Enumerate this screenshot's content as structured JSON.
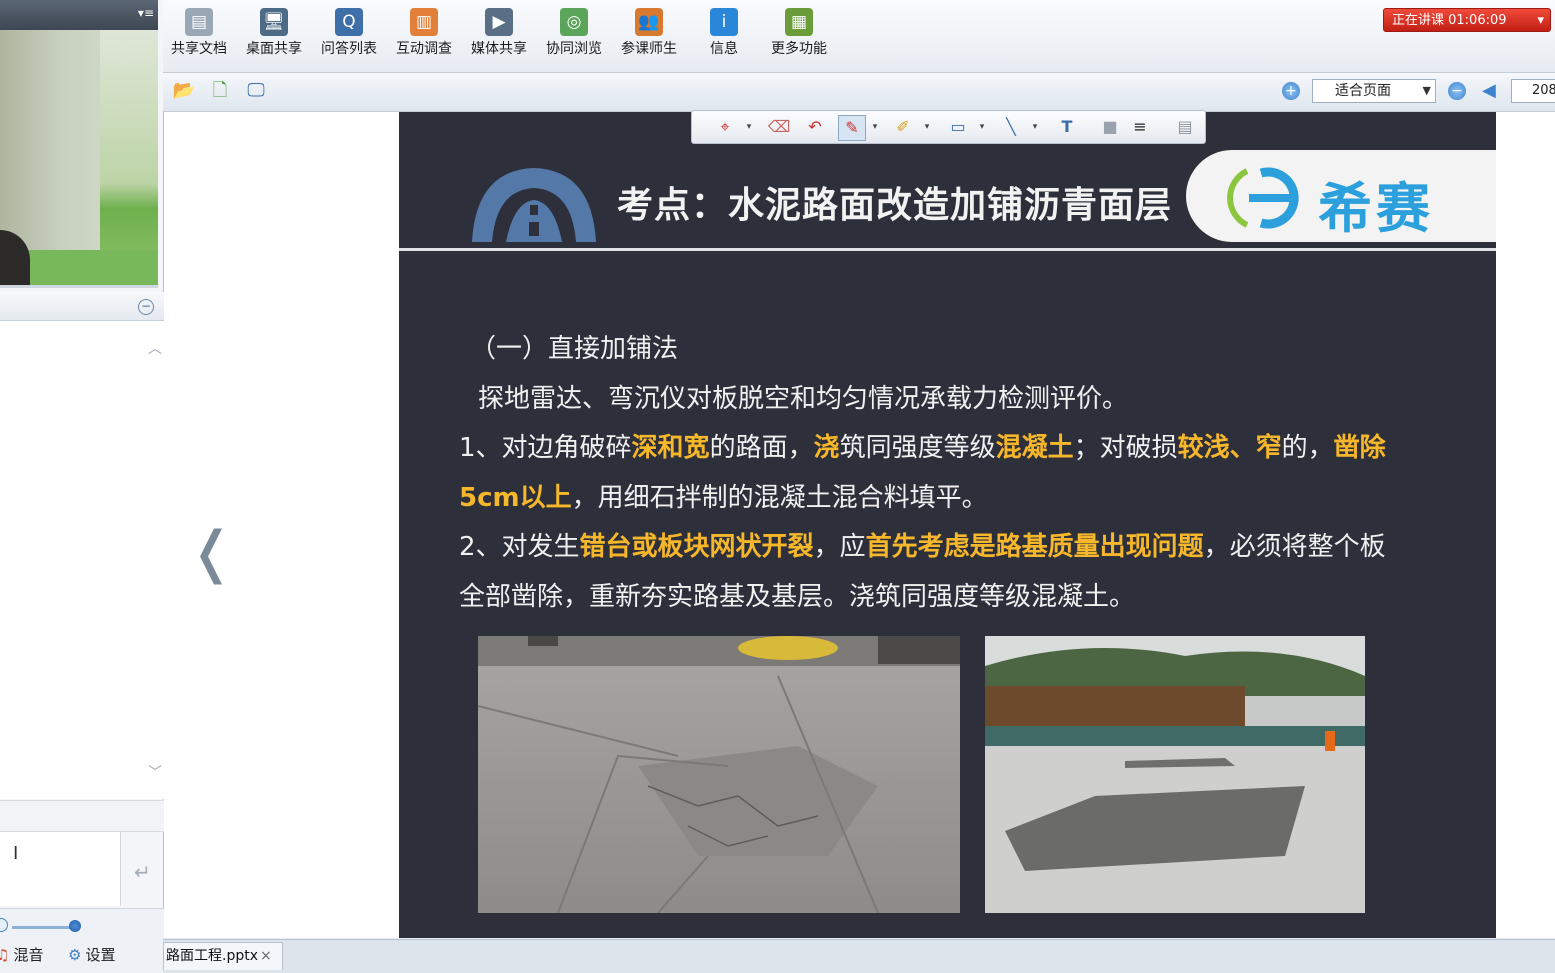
{
  "toolbar": {
    "tools": [
      {
        "label": "共享文档",
        "icon": "document-icon",
        "color": "#9aa7b5"
      },
      {
        "label": "桌面共享",
        "icon": "desktop-share-icon",
        "color": "#4d6a86"
      },
      {
        "label": "问答列表",
        "icon": "qa-list-icon",
        "color": "#3f6fa8"
      },
      {
        "label": "互动调查",
        "icon": "survey-chart-icon",
        "color": "#e2803a"
      },
      {
        "label": "媒体共享",
        "icon": "media-share-icon",
        "color": "#5a6f86"
      },
      {
        "label": "协同浏览",
        "icon": "co-browse-icon",
        "color": "#5aa55a"
      },
      {
        "label": "参课师生",
        "icon": "participants-icon",
        "color": "#d77a2f"
      },
      {
        "label": "信息",
        "icon": "info-icon",
        "color": "#2a86d9"
      },
      {
        "label": "更多功能",
        "icon": "more-features-icon",
        "color": "#6b9c3a"
      }
    ],
    "live_status": "正在讲课 01:06:09"
  },
  "toolbar2": {
    "zoom_mode": "适合页面",
    "page_number": "208"
  },
  "left_panel": {
    "mix_label": "混音",
    "settings_label": "设置"
  },
  "slide": {
    "title": "考点：水泥路面改造加铺沥青面层",
    "brand": "希赛",
    "heading": "（一）直接加铺法",
    "intro": "探地雷达、弯沉仪对板脱空和均匀情况承载力检测评价。",
    "p1": [
      {
        "t": "1、对边角破碎",
        "hl": false
      },
      {
        "t": "深和宽",
        "hl": true
      },
      {
        "t": "的路面，",
        "hl": false
      },
      {
        "t": "浇",
        "hl": true
      },
      {
        "t": "筑同强度等级",
        "hl": false
      },
      {
        "t": "混凝土",
        "hl": true
      },
      {
        "t": "；对破损",
        "hl": false
      },
      {
        "t": "较浅、窄",
        "hl": true
      },
      {
        "t": "的，",
        "hl": false
      },
      {
        "t": "凿除",
        "hl": true
      }
    ],
    "p1b": [
      {
        "t": "5cm以上",
        "hl": true
      },
      {
        "t": "，用细石拌制的混凝土混合料填平。",
        "hl": false
      }
    ],
    "p2": [
      {
        "t": "2、对发生",
        "hl": false
      },
      {
        "t": "错台或板块网状开裂",
        "hl": true
      },
      {
        "t": "，应",
        "hl": false
      },
      {
        "t": "首先考虑是路基质量出现问题",
        "hl": true
      },
      {
        "t": "，必须将整个板",
        "hl": false
      }
    ],
    "p2b": "全部凿除，重新夯实路基及基层。浇筑同强度等级混凝土。"
  },
  "file_tab": {
    "name": "路面工程.pptx",
    "close": "×"
  },
  "colors": {
    "highlight": "#f7b72a",
    "slide_bg": "#2d2f3b",
    "brand_blue": "#2ba0dc",
    "live_red": "#d8281c"
  }
}
